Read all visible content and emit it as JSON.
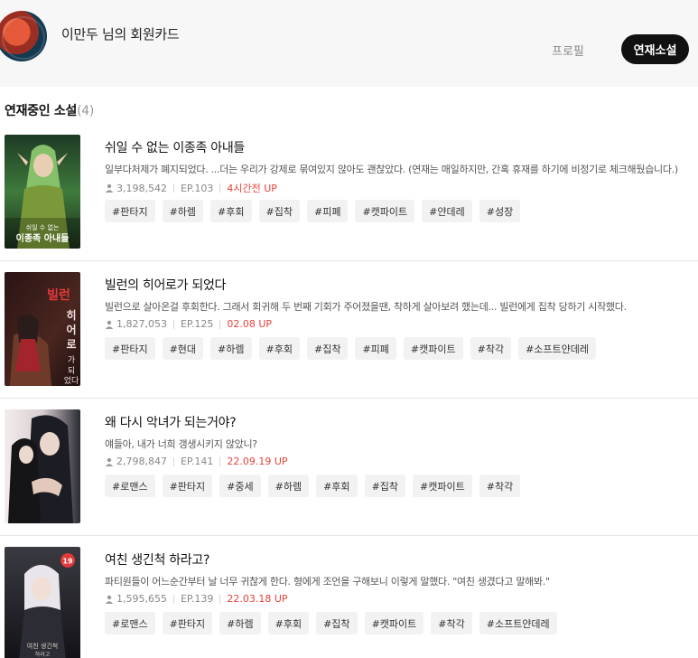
{
  "header": {
    "user_title": "이만두 님의 회원카드",
    "tabs": {
      "profile": "프로필",
      "serial": "연재소설"
    }
  },
  "section": {
    "title": "연재중인 소설",
    "count": "(4)"
  },
  "colors": {
    "accent": "#111111",
    "update": "#e8423b",
    "tag_bg": "#f2f2f2",
    "header_bg": "#f7f7f7"
  },
  "novels": [
    {
      "title": "쉬일 수 없는 이종족 아내들",
      "description": "일부다처제가 폐지되었다. ...더는 우리가 강제로 묶여있지 않아도 괜찮았다. (연재는 매일하지만, 간혹 휴재를 하기에 비정기로 체크해뒀습니다.)",
      "views": "3,198,542",
      "episode": "EP.103",
      "update": "4시간전 UP",
      "cover_text": "쉬일 수 없는 이종족 아내들",
      "tags": [
        "#판타지",
        "#하렘",
        "#후회",
        "#집착",
        "#피폐",
        "#캣파이트",
        "#얀데레",
        "#성장"
      ]
    },
    {
      "title": "빌런의 히어로가 되었다",
      "description": "빌런으로 살아온걸 후회한다. 그래서 회귀해 두 번째 기회가 주어졌을땐, 착하게 살아보려 했는데... 빌런에게 집착 당하기 시작했다.",
      "views": "1,827,053",
      "episode": "EP.125",
      "update": "02.08 UP",
      "cover_text": "빌런의 히어로가 되었다",
      "tags": [
        "#판타지",
        "#현대",
        "#하렘",
        "#후회",
        "#집착",
        "#피폐",
        "#캣파이트",
        "#착각",
        "#소프트얀데레"
      ]
    },
    {
      "title": "왜 다시 악녀가 되는거야?",
      "description": "얘들아, 내가 너희 갱생시키지 않았니?",
      "views": "2,798,847",
      "episode": "EP.141",
      "update": "22.09.19 UP",
      "cover_text": "",
      "tags": [
        "#로맨스",
        "#판타지",
        "#중세",
        "#하렘",
        "#후회",
        "#집착",
        "#캣파이트",
        "#착각"
      ]
    },
    {
      "title": "여친 생긴척 하라고?",
      "description": "파티원들이 어느순간부터 날 너무 귀찮게 한다. 형에게 조언을 구해보니 이렇게 말했다. \"여친 생겼다고 말해봐.\"",
      "views": "1,595,655",
      "episode": "EP.139",
      "update": "22.03.18 UP",
      "cover_text": "여친 생긴척 하라고",
      "cover_badge": "19",
      "tags": [
        "#로맨스",
        "#판타지",
        "#하렘",
        "#후회",
        "#집착",
        "#캣파이트",
        "#착각",
        "#소프트얀데레"
      ]
    }
  ]
}
